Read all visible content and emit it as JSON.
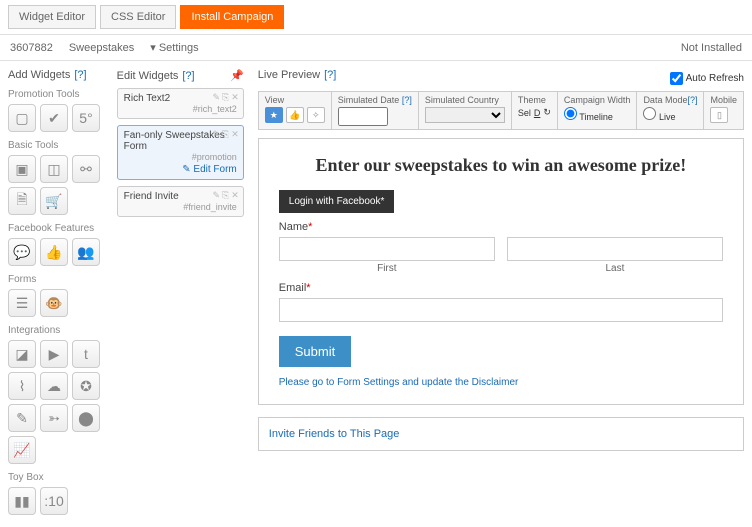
{
  "tabs": {
    "widget_editor": "Widget Editor",
    "css_editor": "CSS Editor",
    "install": "Install Campaign"
  },
  "subbar": {
    "id": "3607882",
    "type": "Sweepstakes",
    "settings": "Settings",
    "status": "Not Installed"
  },
  "panels": {
    "add": {
      "title": "Add Widgets",
      "help": "[?]"
    },
    "edit": {
      "title": "Edit Widgets",
      "help": "[?]"
    },
    "preview": {
      "title": "Live Preview",
      "help": "[?]",
      "auto_refresh": "Auto Refresh"
    }
  },
  "categories": {
    "promotion": "Promotion Tools",
    "basic": "Basic Tools",
    "facebook": "Facebook Features",
    "forms": "Forms",
    "integrations": "Integrations",
    "toybox": "Toy Box"
  },
  "widgets": [
    {
      "name": "Rich Text2",
      "hash": "#rich_text2"
    },
    {
      "name": "Fan-only Sweepstakes Form",
      "hash": "#promotion",
      "edit_label": "Edit Form"
    },
    {
      "name": "Friend Invite",
      "hash": "#friend_invite"
    }
  ],
  "toolbar": {
    "view": "View",
    "sim_date": "Simulated Date",
    "sim_country": "Simulated Country",
    "theme": "Theme",
    "theme_sel": "Sel",
    "campaign_width": "Campaign Width",
    "timeline": "Timeline",
    "data_mode": "Data Mode",
    "mobile": "Mobile",
    "live": "Live",
    "help": "[?]"
  },
  "form": {
    "heading": "Enter our sweepstakes to win an awesome prize!",
    "login_fb": "Login with Facebook*",
    "name_label": "Name",
    "first": "First",
    "last": "Last",
    "email_label": "Email",
    "submit": "Submit",
    "disclaimer": "Please go to Form Settings and update the Disclaimer",
    "invite": "Invite Friends to This Page"
  }
}
